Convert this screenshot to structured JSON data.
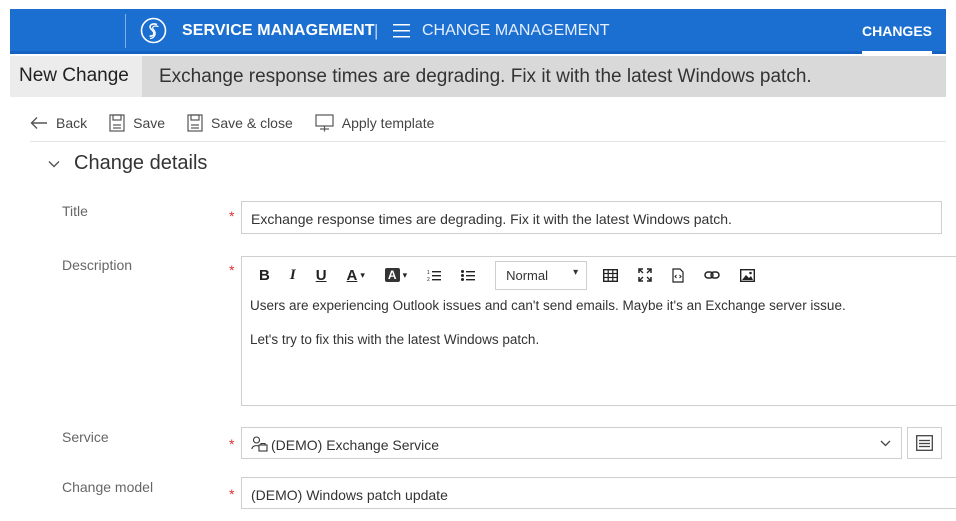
{
  "topbar": {
    "app_title": "SERVICE MANAGEMENT",
    "separator": "|",
    "module": "CHANGE MANAGEMENT",
    "active_tab": "CHANGES",
    "brand_color": "#1b6fd1"
  },
  "record": {
    "type": "New Change",
    "title": "Exchange response times are degrading. Fix it with the latest Windows patch."
  },
  "toolbar": {
    "back_label": "Back",
    "save_label": "Save",
    "save_close_label": "Save & close",
    "apply_template_label": "Apply template"
  },
  "section": {
    "label": "Change details"
  },
  "form": {
    "required_marker": "*",
    "title": {
      "label": "Title",
      "value": "Exchange response times are degrading. Fix it with the latest Windows patch."
    },
    "description": {
      "label": "Description",
      "format_select": "Normal",
      "paragraphs": [
        "Users are experiencing Outlook issues and can't send emails. Maybe it's an Exchange server issue.",
        "Let's try to fix this with the latest Windows patch."
      ],
      "toolbar_buttons": [
        "B",
        "I",
        "U",
        "A",
        "A"
      ]
    },
    "service": {
      "label": "Service",
      "value": "(DEMO) Exchange Service"
    },
    "change_model": {
      "label": "Change model",
      "value": "(DEMO) Windows patch update"
    }
  }
}
